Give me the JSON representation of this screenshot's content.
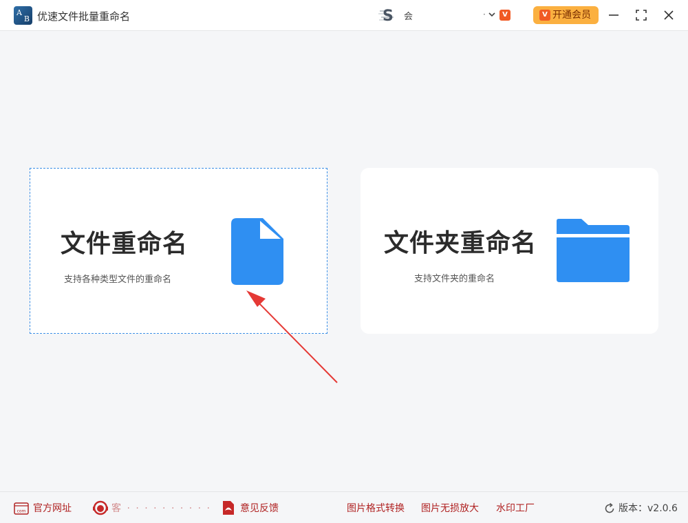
{
  "app": {
    "title": "优速文件批量重命名",
    "logo_letters": [
      "A",
      "B"
    ]
  },
  "user": {
    "name": "会",
    "dot": "·",
    "vip_badge": "V"
  },
  "header": {
    "vip_button_label": "开通会员",
    "vip_button_icon_letter": "V"
  },
  "cards": {
    "file": {
      "title": "文件重命名",
      "desc": "支持各种类型文件的重命名"
    },
    "folder": {
      "title": "文件夹重命名",
      "desc": "支持文件夹的重命名"
    }
  },
  "footer": {
    "website": "官方网址",
    "support_text": "客 · · · · · · · · · ·",
    "feedback": "意见反馈",
    "image_convert": "图片格式转换",
    "image_enlarge": "图片无损放大",
    "watermark": "水印工厂",
    "version": "版本：v2.0.6",
    "site_icon_text": "com"
  },
  "colors": {
    "accent": "#3a8ee6",
    "icon_blue": "#2f8ff2",
    "vip_orange": "#fbb040",
    "footer_red": "#b02222",
    "arrow_red": "#e53935"
  }
}
